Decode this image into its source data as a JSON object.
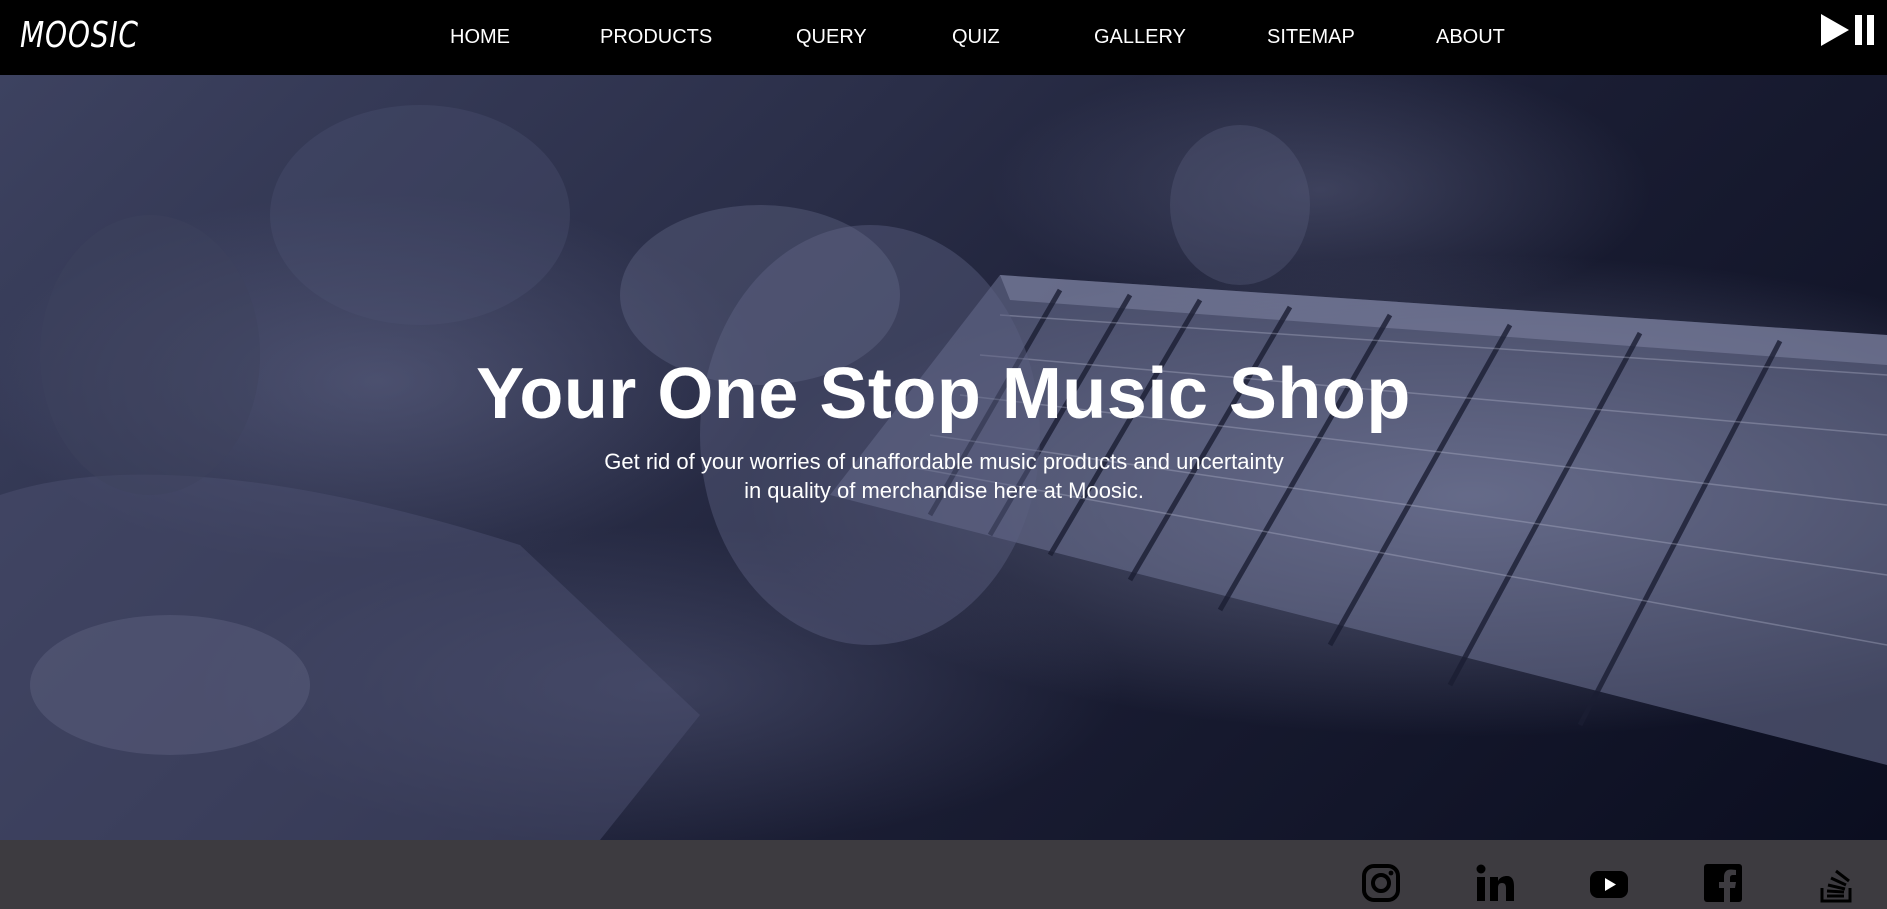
{
  "brand": {
    "logo_text": "MOOSIC"
  },
  "nav": {
    "items": [
      {
        "label": "HOME"
      },
      {
        "label": "PRODUCTS"
      },
      {
        "label": "QUERY"
      },
      {
        "label": "QUIZ"
      },
      {
        "label": "GALLERY"
      },
      {
        "label": "SITEMAP"
      },
      {
        "label": "ABOUT"
      }
    ],
    "media_control_icon": "play-pause-icon"
  },
  "hero": {
    "title": "Your One Stop Music Shop",
    "subtitle_line1": "Get rid of your worries of unaffordable music products and uncertainty",
    "subtitle_line2": "in quality of merchandise here at Moosic.",
    "background_description_icon": "guitar-photo-background"
  },
  "footer": {
    "social_icons": [
      "instagram-icon",
      "linkedin-icon",
      "youtube-icon",
      "facebook-icon",
      "stackoverflow-icon"
    ]
  },
  "colors": {
    "navbar_bg": "#000000",
    "hero_overlay": "#1a1d33",
    "footer_bg": "#3d3b40",
    "text": "#ffffff",
    "icon": "#000000"
  }
}
